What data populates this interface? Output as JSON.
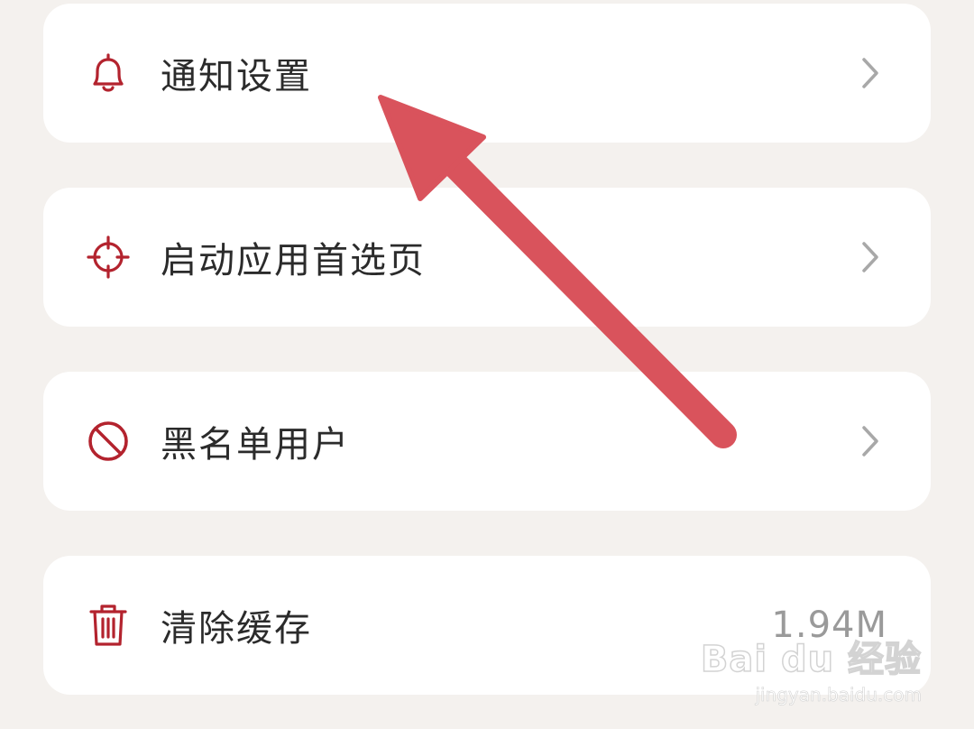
{
  "settings": {
    "items": [
      {
        "label": "通知设置",
        "icon": "bell-icon"
      },
      {
        "label": "启动应用首选页",
        "icon": "crosshair-icon"
      },
      {
        "label": "黑名单用户",
        "icon": "block-icon"
      },
      {
        "label": "清除缓存",
        "icon": "trash-icon",
        "value": "1.94M"
      }
    ]
  },
  "annotation": {
    "arrow_color": "#d9535c"
  },
  "colors": {
    "accent": "#b3232e",
    "chevron": "#a8a8a8",
    "background": "#f4f1ee",
    "card": "#ffffff"
  },
  "watermark": {
    "main": "Bai du 经验",
    "sub": "jingyan.baidu.com"
  }
}
